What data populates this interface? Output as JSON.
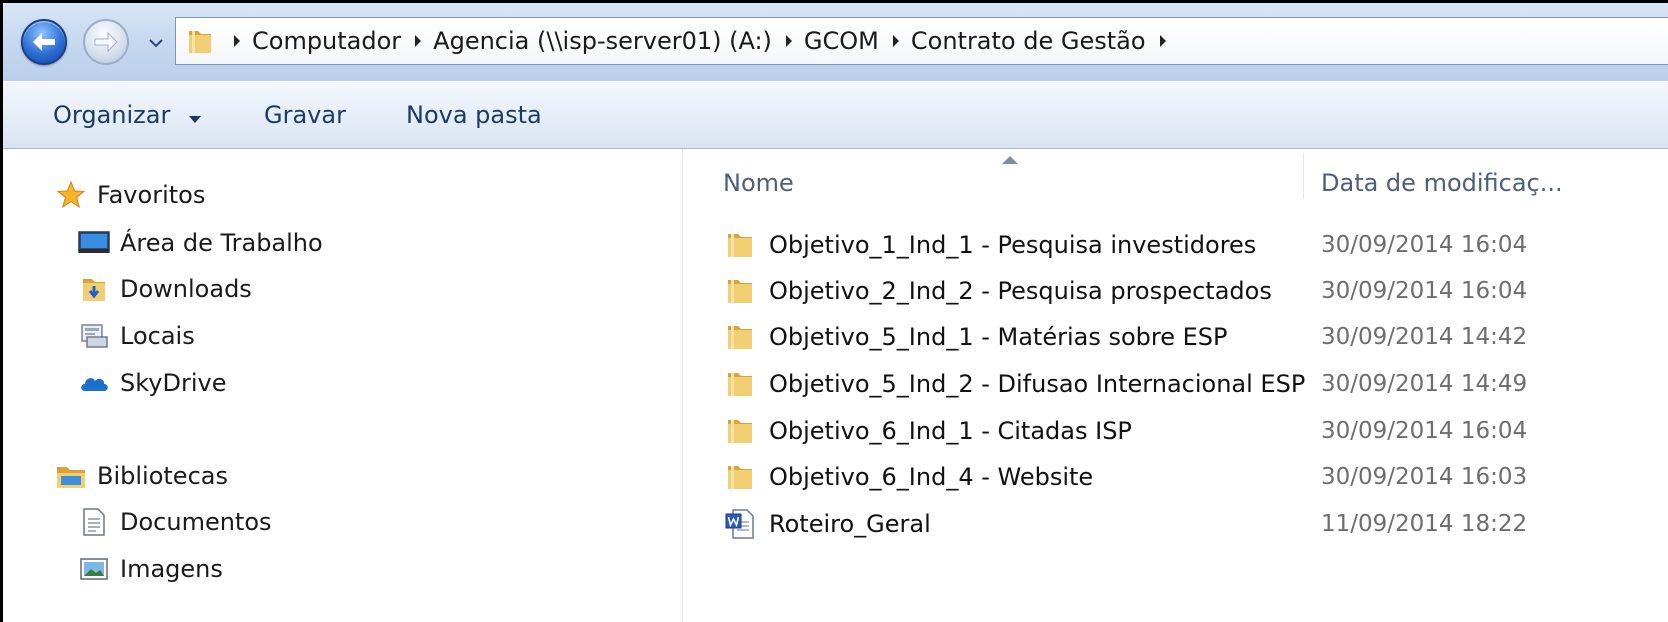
{
  "address_bar": {
    "breadcrumbs": [
      "Computador",
      "Agencia (\\\\isp-server01) (A:)",
      "GCOM",
      "Contrato de Gestão"
    ]
  },
  "toolbar": {
    "organize_label": "Organizar",
    "burn_label": "Gravar",
    "new_folder_label": "Nova pasta"
  },
  "nav": {
    "favorites_label": "Favoritos",
    "favorites": [
      {
        "label": "Área de Trabalho",
        "icon": "desktop-icon"
      },
      {
        "label": "Downloads",
        "icon": "downloads-icon"
      },
      {
        "label": "Locais",
        "icon": "recent-places-icon"
      },
      {
        "label": "SkyDrive",
        "icon": "skydrive-icon"
      }
    ],
    "libraries_label": "Bibliotecas",
    "libraries": [
      {
        "label": "Documentos",
        "icon": "documents-icon"
      },
      {
        "label": "Imagens",
        "icon": "pictures-icon"
      }
    ]
  },
  "file_list": {
    "columns": {
      "name": "Nome",
      "modified": "Data de modificaç..."
    },
    "rows": [
      {
        "name": "Objetivo_1_Ind_1 - Pesquisa investidores",
        "modified": "30/09/2014 16:04",
        "icon": "folder-icon"
      },
      {
        "name": "Objetivo_2_Ind_2 - Pesquisa prospectados",
        "modified": "30/09/2014 16:04",
        "icon": "folder-icon"
      },
      {
        "name": "Objetivo_5_Ind_1 - Matérias sobre ESP",
        "modified": "30/09/2014 14:42",
        "icon": "folder-icon"
      },
      {
        "name": "Objetivo_5_Ind_2 - Difusao Internacional ESP",
        "modified": "30/09/2014 14:49",
        "icon": "folder-icon"
      },
      {
        "name": "Objetivo_6_Ind_1 - Citadas ISP",
        "modified": "30/09/2014 16:04",
        "icon": "folder-icon"
      },
      {
        "name": "Objetivo_6_Ind_4 - Website",
        "modified": "30/09/2014 16:03",
        "icon": "folder-icon"
      },
      {
        "name": "Roteiro_Geral",
        "modified": "11/09/2014 18:22",
        "icon": "word-document-icon"
      }
    ]
  },
  "colors": {
    "folder": "#e8b54a",
    "accent": "#2b6fd6",
    "toolbar_text": "#1e3a5f",
    "date_text": "#6d6d6d"
  }
}
